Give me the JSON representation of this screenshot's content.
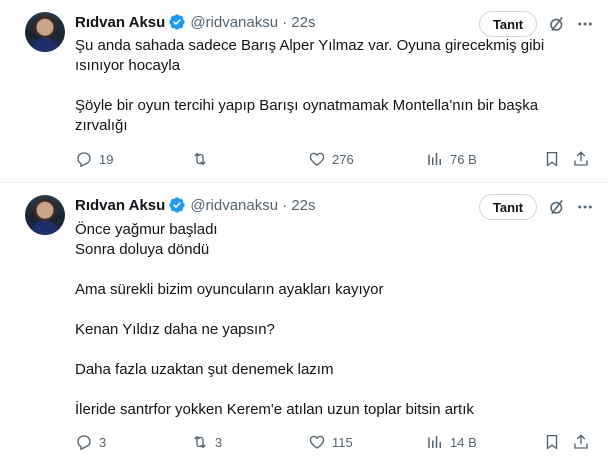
{
  "tweets": [
    {
      "author": {
        "name": "Rıdvan Aksu",
        "handle": "@ridvanaksu",
        "time": "· 22s"
      },
      "follow_label": "Tanıt",
      "text_lines": [
        "Şu anda sahada sadece Barış Alper Yılmaz var. Oyuna girecekmiş gibi ısınıyor hocayla",
        "",
        "Şöyle bir oyun tercihi yapıp Barışı oynatmamak Montella'nın bir başka zırvalığı"
      ],
      "stats": {
        "replies": "19",
        "reposts": "",
        "likes": "276",
        "views": "76 B"
      }
    },
    {
      "author": {
        "name": "Rıdvan Aksu",
        "handle": "@ridvanaksu",
        "time": "· 22s"
      },
      "follow_label": "Tanıt",
      "text_lines": [
        "Önce yağmur başladı",
        "Sonra doluya döndü",
        "",
        "Ama sürekli bizim oyuncuların ayakları kayıyor",
        "",
        "Kenan Yıldız daha ne yapsın?",
        "",
        "Daha fazla uzaktan şut denemek lazım",
        "",
        "İleride santrfor yokken Kerem'e atılan uzun toplar bitsin artık"
      ],
      "stats": {
        "replies": "3",
        "reposts": "3",
        "likes": "115",
        "views": "14 B"
      }
    }
  ],
  "icons": {
    "verified": "verified-badge-icon",
    "grok": "grok-icon",
    "more": "more-icon",
    "reply": "reply-icon",
    "repost": "repost-icon",
    "like": "like-icon",
    "views": "views-icon",
    "bookmark": "bookmark-icon",
    "share": "share-icon"
  },
  "colors": {
    "verified": "#1d9bf0",
    "secondary_text": "#536471",
    "primary_text": "#0f1419",
    "border": "#cfd9de"
  }
}
